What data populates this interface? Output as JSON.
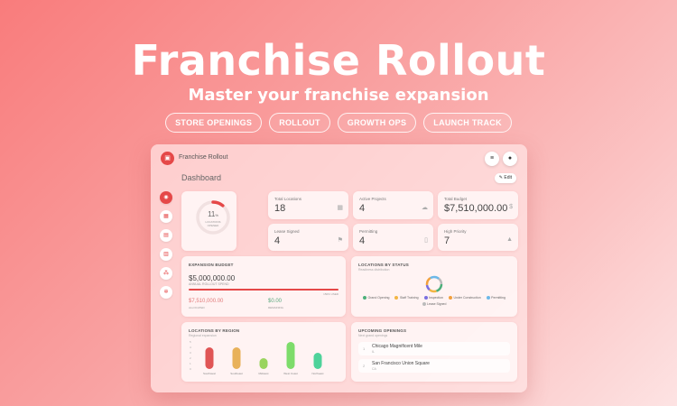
{
  "hero": {
    "title": "Franchise Rollout",
    "subtitle": "Master your franchise expansion",
    "pills": [
      "STORE OPENINGS",
      "ROLLOUT",
      "GROWTH OPS",
      "LAUNCH TRACK"
    ]
  },
  "app": {
    "title": "Franchise Rollout",
    "page_title": "Dashboard",
    "edit_label": "Edit",
    "logo_icon": "store-icon",
    "menu_icon": "menu-icon",
    "user_icon": "user-icon"
  },
  "sidebar": {
    "items": [
      {
        "icon": "dashboard-icon",
        "active": true
      },
      {
        "icon": "calendar-icon",
        "active": false
      },
      {
        "icon": "store-icon",
        "active": false
      },
      {
        "icon": "building-icon",
        "active": false
      },
      {
        "icon": "org-chart-icon",
        "active": false
      },
      {
        "icon": "settings-icon",
        "active": false
      }
    ]
  },
  "gauge": {
    "percent": "11",
    "suffix": "%",
    "label_line1": "LOCATIONS",
    "label_line2": "OPENED",
    "fraction": 0.11,
    "color": "#e54848"
  },
  "stats": [
    {
      "label": "Total Locations",
      "value": "18",
      "icon": "calendar-icon"
    },
    {
      "label": "Active Projects",
      "value": "4",
      "icon": "cloud-icon"
    },
    {
      "label": "Total Budget",
      "value": "$7,510,000.00",
      "icon": "dollar-icon"
    },
    {
      "label": "Lease Signed",
      "value": "4",
      "icon": "flag-icon"
    },
    {
      "label": "Permitting",
      "value": "4",
      "icon": "document-icon"
    },
    {
      "label": "High Priority",
      "value": "7",
      "icon": "warning-icon"
    }
  ],
  "budget": {
    "heading": "EXPANSION BUDGET",
    "amount": "$5,000,000.00",
    "amount_label": "ANNUAL ROLLOUT SPEND",
    "progress_label": "150% USED",
    "progress_fraction": 1.0,
    "allocated_value": "$7,510,000.00",
    "allocated_label": "ALLOCATED",
    "remaining_value": "$0.00",
    "remaining_label": "REMAINING",
    "bar_color": "#e54848"
  },
  "status": {
    "heading": "LOCATIONS BY STATUS",
    "subheading": "Readiness distribution",
    "legend": [
      {
        "label": "Grand Opening",
        "color": "#4caf7a"
      },
      {
        "label": "Staff Training",
        "color": "#f2b544"
      },
      {
        "label": "Inspection",
        "color": "#7a6fe0"
      },
      {
        "label": "Under Construction",
        "color": "#f2a03c"
      },
      {
        "label": "Permitting",
        "color": "#6cb8e8"
      },
      {
        "label": "Lease Signed",
        "color": "#bbbbbb"
      }
    ]
  },
  "region": {
    "heading": "LOCATIONS BY REGION",
    "subheading": "Regional expansion"
  },
  "chart_data": {
    "type": "bar",
    "categories": [
      "Southwest",
      "Southeast",
      "Midwest",
      "West Coast",
      "Northeast"
    ],
    "values": [
      4,
      4,
      2,
      5,
      3
    ],
    "ylim": [
      0,
      5
    ],
    "yticks": [
      "0",
      "1",
      "2",
      "3",
      "4",
      "5"
    ],
    "colors": [
      "#e05555",
      "#e8b15a",
      "#9ad45e",
      "#7ddc6a",
      "#4ed29a"
    ],
    "grid": false,
    "legend": "none"
  },
  "openings": {
    "heading": "UPCOMING OPENINGS",
    "subheading": "Next grand openings",
    "items": [
      {
        "num": "1",
        "name": "Chicago Magnificent Mile",
        "meta": "IL"
      },
      {
        "num": "2",
        "name": "San Francisco Union Square",
        "meta": "CA"
      }
    ]
  }
}
